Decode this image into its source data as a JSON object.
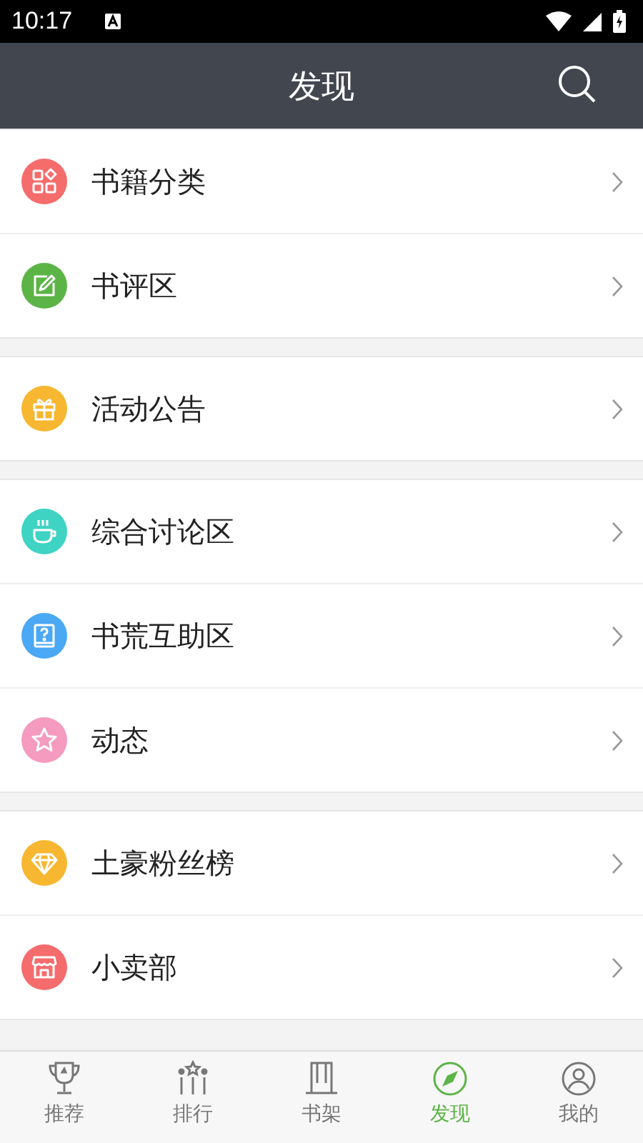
{
  "status_bar": {
    "time": "10:17"
  },
  "header": {
    "title": "发现"
  },
  "groups": [
    {
      "items": [
        {
          "label": "书籍分类",
          "kind": "category",
          "color": "#f56c6c"
        },
        {
          "label": "书评区",
          "kind": "edit",
          "color": "#5cb447"
        }
      ]
    },
    {
      "items": [
        {
          "label": "活动公告",
          "kind": "gift",
          "color": "#f7b731"
        }
      ]
    },
    {
      "items": [
        {
          "label": "综合讨论区",
          "kind": "cup",
          "color": "#3fd3c4"
        },
        {
          "label": "书荒互助区",
          "kind": "help",
          "color": "#4aa8f5"
        },
        {
          "label": "动态",
          "kind": "star",
          "color": "#f59bbf"
        }
      ]
    },
    {
      "items": [
        {
          "label": "土豪粉丝榜",
          "kind": "diamond",
          "color": "#f7b731"
        },
        {
          "label": "小卖部",
          "kind": "shop",
          "color": "#f56c6c"
        }
      ]
    }
  ],
  "tabs": [
    {
      "label": "推荐",
      "kind": "trophy",
      "selected": false
    },
    {
      "label": "排行",
      "kind": "rank",
      "selected": false
    },
    {
      "label": "书架",
      "kind": "shelf",
      "selected": false
    },
    {
      "label": "发现",
      "kind": "discover",
      "selected": true
    },
    {
      "label": "我的",
      "kind": "me",
      "selected": false
    }
  ]
}
